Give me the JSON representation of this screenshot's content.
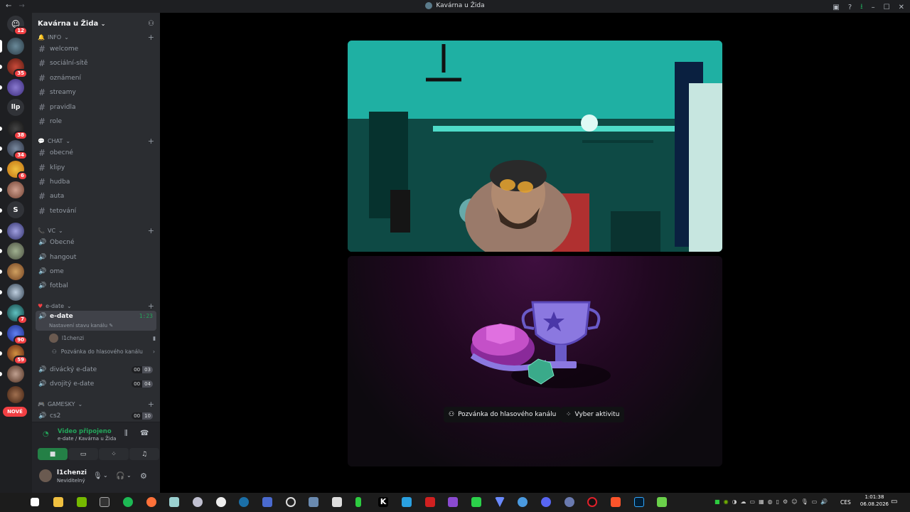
{
  "window": {
    "title": "Kavárna u Žida"
  },
  "servers": {
    "badges": [
      "12",
      "35",
      "38",
      "34",
      "6",
      "7",
      "90",
      "59"
    ],
    "llp": "llp",
    "s": "S",
    "new_label": "NOVÉ"
  },
  "guild": {
    "name": "Kavárna u Žida"
  },
  "categories": {
    "info": "INFO",
    "chat": "CHAT",
    "vc": "VC",
    "edate": "e-date",
    "gamesky": "GAMESKY"
  },
  "info_channels": [
    "welcome",
    "sociální-sítě",
    "oznámení",
    "streamy",
    "pravidla",
    "role"
  ],
  "chat_channels": [
    "obecné",
    "klipy",
    "hudba",
    "auta",
    "tetování"
  ],
  "vc_channels": [
    "Obecné",
    "hangout",
    "ome",
    "fotbal"
  ],
  "edate": {
    "active_channel": "e-date",
    "timer": "1:23",
    "status_hint": "Nastavení stavu kanálu",
    "member": "l1chenzi",
    "invite": "Pozvánka do hlasového kanálu",
    "divacky": "divácký e-date",
    "divacky_counts": [
      "00",
      "03"
    ],
    "dvojity": "dvojitý e-date",
    "dvojity_counts": [
      "00",
      "04"
    ]
  },
  "gamesky": {
    "cs2": "cs2",
    "cs2_counts": [
      "00",
      "10"
    ]
  },
  "voice_panel": {
    "status": "Video připojeno",
    "location": "e-date / Kavárna u Žida"
  },
  "user": {
    "name": "l1chenzi",
    "status": "Neviditelný"
  },
  "activity": {
    "invite_button": "Pozvánka do hlasového kanálu",
    "choose_button": "Vyber aktivitu"
  },
  "taskbar": {
    "lang": "CES",
    "time": "1:01:38",
    "date": "06.08.2026"
  },
  "colors": {
    "accent_green": "#23a55a",
    "badge_red": "#f23f43",
    "sidebar_bg": "#2b2d31"
  }
}
